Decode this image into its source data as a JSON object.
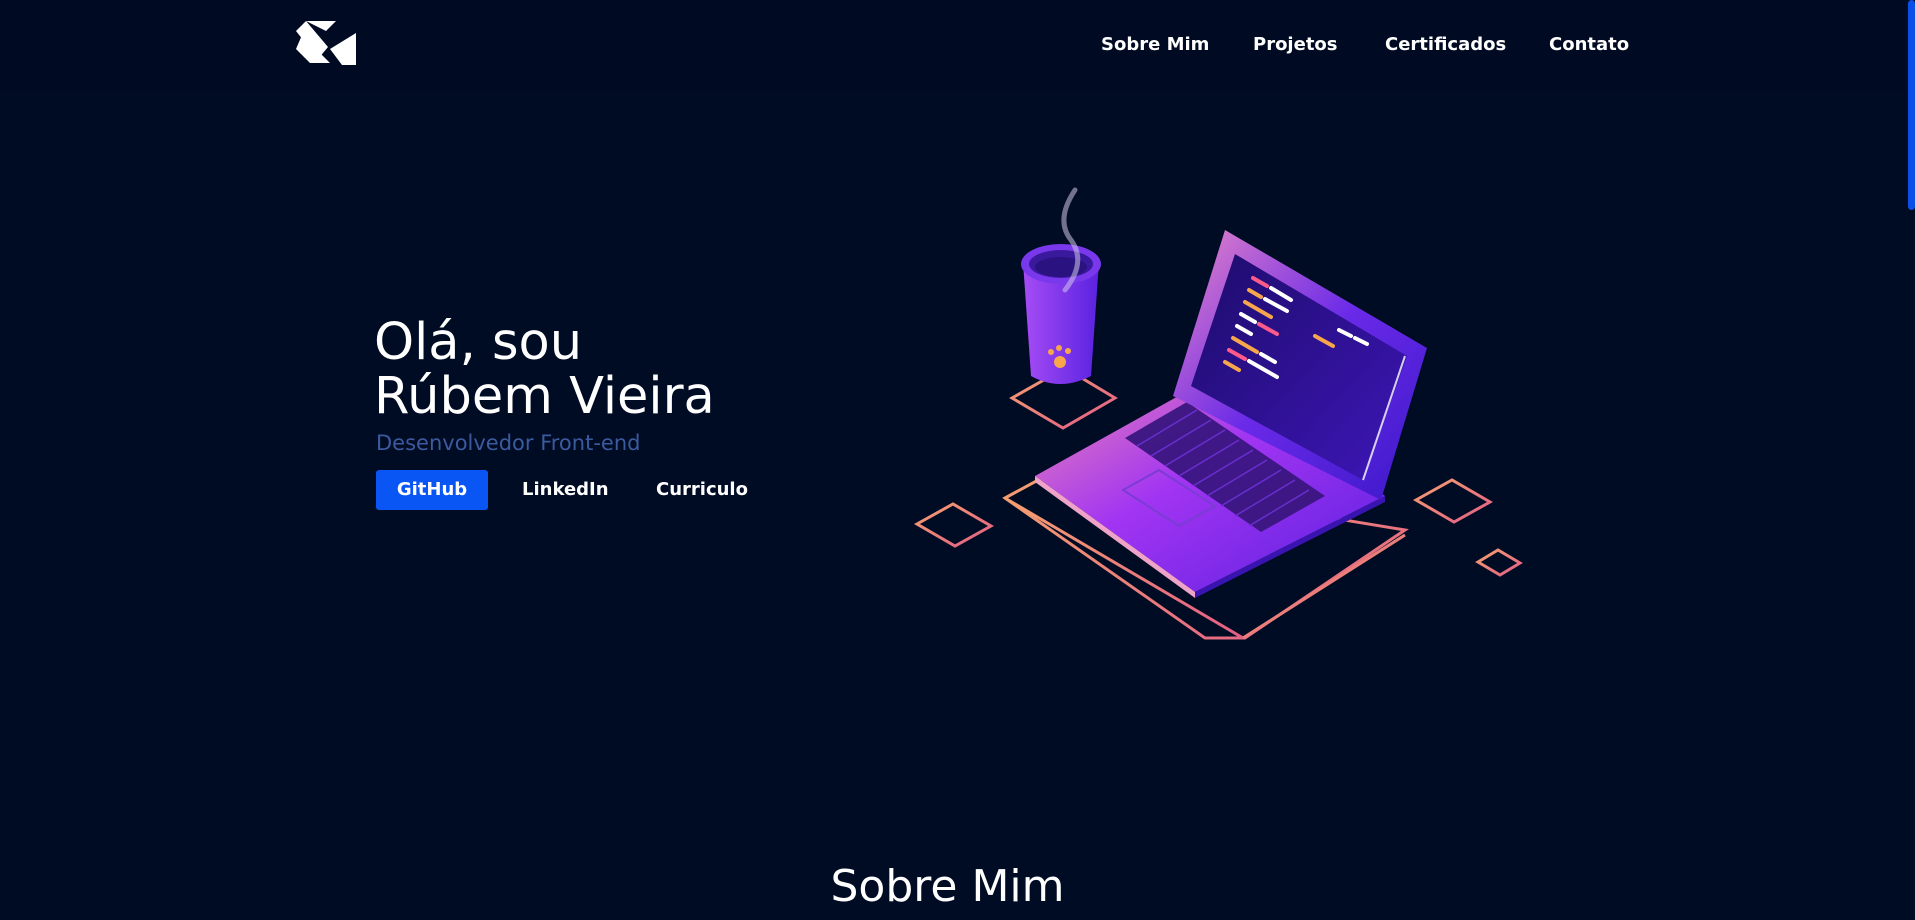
{
  "header": {
    "logo_icon": "brand-logo-icon",
    "nav": [
      {
        "label": "Sobre Mim"
      },
      {
        "label": "Projetos"
      },
      {
        "label": "Certificados"
      },
      {
        "label": "Contato"
      }
    ]
  },
  "hero": {
    "title_line1": "Olá, sou",
    "title_line2": "Rúbem Vieira",
    "subtitle": "Desenvolvedor Front-end",
    "buttons": {
      "github": "GitHub",
      "linkedin": "LinkedIn",
      "curriculo": "Curriculo"
    },
    "illustration_icon": "laptop-coffee-illustration"
  },
  "about": {
    "title": "Sobre Mim"
  },
  "colors": {
    "background": "#000b24",
    "accent": "#0a56f5",
    "subtitle": "#3c5a9e",
    "outline": "#f27d6b",
    "laptop_purple": "#7b2bf0"
  }
}
